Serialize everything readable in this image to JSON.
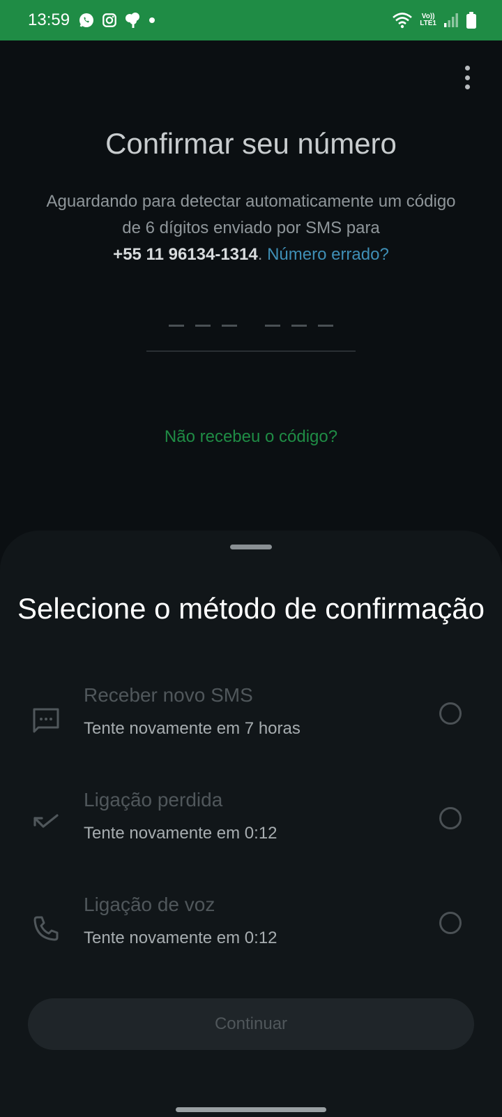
{
  "status_bar": {
    "time": "13:59",
    "left_icons": [
      "whatsapp-icon",
      "instagram-icon",
      "tree-icon",
      "notification-dot"
    ],
    "right_icons": [
      "wifi-icon",
      "volte-lte-icon",
      "signal-icon",
      "battery-icon"
    ],
    "lte_line1": "Vo))",
    "lte_line2": "LTE1",
    "color": "#1f8c45"
  },
  "header": {
    "title": "Confirmar seu número"
  },
  "description": {
    "text": "Aguardando para detectar automaticamente um código de 6 dígitos enviado por SMS para",
    "phone": "+55 11 96134-1314",
    "separator": ".",
    "wrong_number_link": "Número errado?"
  },
  "code_input": {
    "placeholder": "--- ---"
  },
  "resend_link": "Não recebeu o código?",
  "sheet": {
    "title": "Selecione o método de confirmação",
    "options": [
      {
        "label": "Receber novo SMS",
        "sub": "Tente novamente em 7 horas",
        "icon": "message-icon"
      },
      {
        "label": "Ligação perdida",
        "sub": "Tente novamente em 0:12",
        "icon": "missed-call-icon"
      },
      {
        "label": "Ligação de voz",
        "sub": "Tente novamente em 0:12",
        "icon": "phone-icon"
      }
    ],
    "continue_label": "Continuar"
  },
  "colors": {
    "accent_green": "#1f8c45",
    "link_blue": "#3f8fb6",
    "background": "#0b0f12",
    "sheet_background": "#111619"
  }
}
